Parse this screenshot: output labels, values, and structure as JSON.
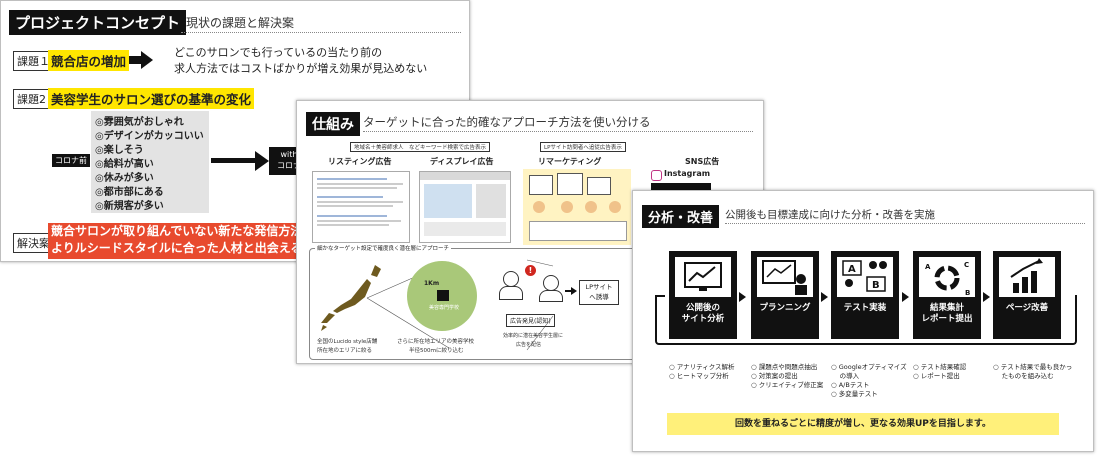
{
  "slide1": {
    "title_tag": "プロジェクトコンセプト",
    "subtitle": "現状の課題と解決案",
    "issue1_label": "課題１",
    "issue1_highlight": "競合店の増加",
    "issue1_text_line1": "どこのサロンでも行っているの当たり前の",
    "issue1_text_line2": "求人方法ではコストばかりが増え効果が見込めない",
    "issue2_label": "課題2",
    "issue2_highlight": "美容学生のサロン選びの基準の変化",
    "corona_before": "コロナ前",
    "with_corona_line1": "with",
    "with_corona_line2": "コロナ",
    "criteria": [
      "◎雰囲気がおしゃれ",
      "◎デザインがカッコいい",
      "◎楽しそう",
      "◎給料が高い",
      "◎休みが多い",
      "◎都市部にある",
      "◎新規客が多い"
    ],
    "solution_label": "解決案",
    "solution_line1": "競合サロンが取り組んでいない新たな発信方法",
    "solution_line2": "よりルシードスタイルに合った人材と出会える"
  },
  "slide2": {
    "title_tag": "仕組み",
    "subtitle": "ターゲットに合った的確なアプローチ方法を使い分ける",
    "note_left": "地域名＋美容師求人　などキーワード検索で広告表示",
    "note_right": "LPサイト訪問者へ追従広告表示",
    "col1": "リスティング広告",
    "col2": "ディスプレイ広告",
    "col3": "リマーケティング",
    "col4": "SNS広告",
    "instagram": "Instagram",
    "target_caption": "細かなターゲット設定で確度良く潜在層にアプローチ",
    "radius": "1Km",
    "school": "美容専門学校",
    "map_caption_line1": "全国のLucido style店舗",
    "map_caption_line2": "所在地のエリアに絞る",
    "circle_caption_line1": "さらに所在地エリアの美容学校",
    "circle_caption_line2": "半径500ｍに絞り込む",
    "ad_found": "広告発見(認知)",
    "ad_found_caption_line1": "効率的に潜在美容学生層に",
    "ad_found_caption_line2": "広告を配信",
    "lp_line1": "LPサイト",
    "lp_line2": "へ誘導"
  },
  "slide3": {
    "title_tag": "分析・改善",
    "subtitle": "公開後も目標達成に向けた分析・改善を実施",
    "steps": [
      {
        "line1": "公開後の",
        "line2": "サイト分析"
      },
      {
        "line1": "プランニング",
        "line2": ""
      },
      {
        "line1": "テスト実装",
        "line2": ""
      },
      {
        "line1": "結果集計",
        "line2": "レポート提出"
      },
      {
        "line1": "ページ改善",
        "line2": ""
      }
    ],
    "bullets": [
      [
        "○ アナリティクス解析",
        "○ ヒートマップ分析"
      ],
      [
        "○ 課題点や問題点抽出",
        "○ 対策案の提出",
        "○ クリエイティブ修正案"
      ],
      [
        "○ Googleオプティマイズ",
        "　 の導入",
        "○ A/Bテスト",
        "○ 多変量テスト"
      ],
      [
        "○ テスト結果確認",
        "○ レポート提出"
      ],
      [
        "○ テスト結果で最も良かっ",
        "　 たものを組み込む"
      ]
    ],
    "banner": "回数を重ねるごとに精度が増し、更なる効果UPを目指します。",
    "icon_a": "A",
    "icon_b": "B",
    "icon_c": "C"
  }
}
